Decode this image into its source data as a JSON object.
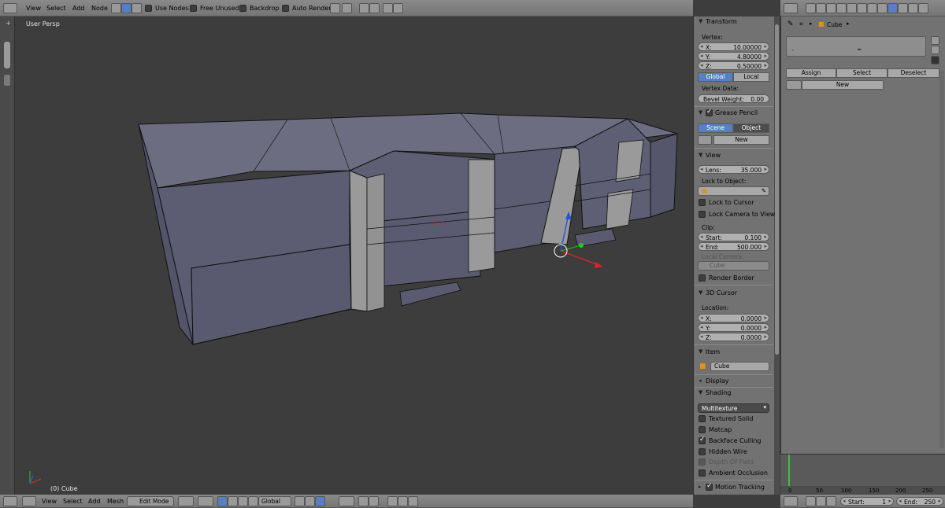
{
  "viewport": {
    "view_label": "User Persp",
    "object_label": "(0) Cube"
  },
  "top_header": {
    "menus": [
      "View",
      "Select",
      "Add",
      "Node"
    ],
    "toggles": [
      {
        "label": "Use Nodes",
        "checked": false
      },
      {
        "label": "Free Unused",
        "checked": false
      },
      {
        "label": "Backdrop",
        "checked": false
      },
      {
        "label": "Auto Render",
        "checked": false
      }
    ]
  },
  "bottom_header": {
    "menus": [
      "View",
      "Select",
      "Add",
      "Mesh"
    ],
    "mode": "Edit Mode",
    "orientation": "Global"
  },
  "n_panel": {
    "transform": {
      "title": "Transform",
      "vertex_label": "Vertex:",
      "x": {
        "key": "X:",
        "value": "10.00000"
      },
      "y": {
        "key": "Y:",
        "value": "4.80000"
      },
      "z": {
        "key": "Z:",
        "value": "0.50000"
      },
      "global": "Global",
      "local": "Local",
      "vertex_data_label": "Vertex Data:",
      "bevel": {
        "key": "Bevel Weight:",
        "value": "0.00"
      }
    },
    "grease_pencil": {
      "title": "Grease Pencil",
      "scene": "Scene",
      "object": "Object",
      "new": "New"
    },
    "view": {
      "title": "View",
      "lens": {
        "key": "Lens:",
        "value": "35.000"
      },
      "lock_to_object": "Lock to Object:",
      "lock_to_cursor": "Lock to Cursor",
      "lock_camera": "Lock Camera to View",
      "clip_label": "Clip:",
      "clip_start": {
        "key": "Start:",
        "value": "0.100"
      },
      "clip_end": {
        "key": "End:",
        "value": "500.000"
      },
      "local_camera": "Local Camera:",
      "local_camera_value": "Cube",
      "render_border": "Render Border"
    },
    "cursor": {
      "title": "3D Cursor",
      "location": "Location:",
      "x": {
        "key": "X:",
        "value": "0.0000"
      },
      "y": {
        "key": "Y:",
        "value": "0.0000"
      },
      "z": {
        "key": "Z:",
        "value": "0.0000"
      }
    },
    "item": {
      "title": "Item",
      "name": "Cube"
    },
    "display": {
      "title": "Display"
    },
    "shading": {
      "title": "Shading",
      "dropdown": "Multitexture",
      "textured_solid": "Textured Solid",
      "matcap": "Matcap",
      "backface": "Backface Culling",
      "hidden_wire": "Hidden Wire",
      "dof": "Depth Of Field",
      "ao": "Ambient Occlusion"
    },
    "motion": {
      "title": "Motion Tracking"
    }
  },
  "properties": {
    "breadcrumb": "Cube",
    "assign": "Assign",
    "select": "Select",
    "deselect": "Deselect",
    "new": "New"
  },
  "timeline": {
    "ticks": [
      "0",
      "50",
      "100",
      "150",
      "200",
      "250"
    ],
    "start": {
      "key": "Start:",
      "value": "1"
    },
    "end": {
      "key": "End:",
      "value": "250"
    }
  },
  "colors": {
    "viewport_bg": "#3d3d3d",
    "accent_blue": "#5680c2",
    "panel_bg": "#727272",
    "mesh_face": "#5c5c72",
    "mesh_face_selected": "#9a9a9a"
  }
}
